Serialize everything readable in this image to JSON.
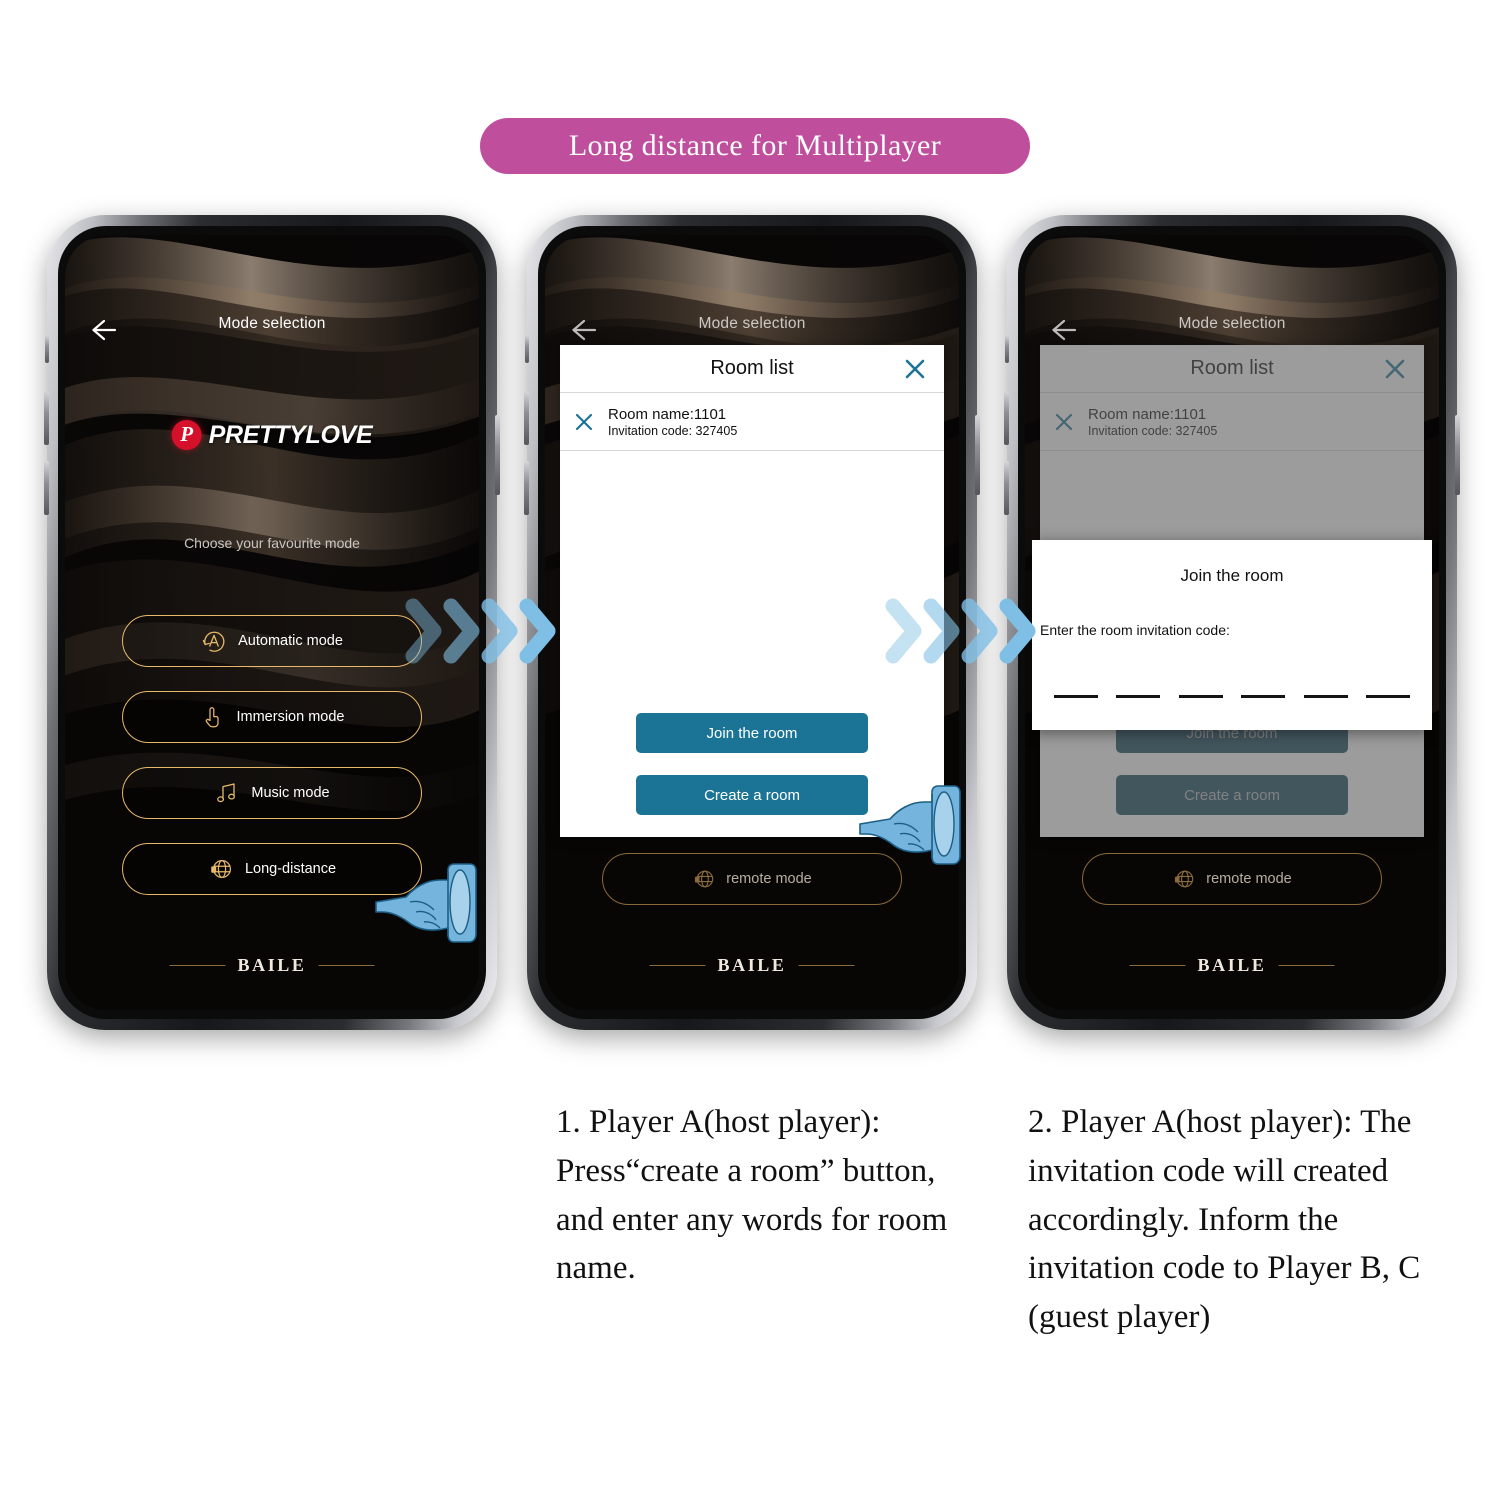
{
  "banner": {
    "title": "Long distance for Multiplayer",
    "color": "#bf4e9d"
  },
  "app": {
    "header_title": "Mode selection",
    "brand_mark": "P",
    "brand_name_bold": "PRETTY",
    "brand_name_light": "LOVE",
    "choose_label": "Choose your favourite mode",
    "footer_brand": "BAILE",
    "accent_gold": "#e7b96a"
  },
  "modes": [
    {
      "label": "Automatic mode",
      "icon": "automatic-mode-icon"
    },
    {
      "label": "Immersion mode",
      "icon": "hand-touch-icon"
    },
    {
      "label": "Music mode",
      "icon": "music-note-icon"
    },
    {
      "label": "Long-distance",
      "icon": "globe-icon"
    }
  ],
  "remote_mode": {
    "label": "remote mode",
    "icon": "globe-icon"
  },
  "room_dialog": {
    "title": "Room list",
    "close_icon": "close-icon",
    "rows": [
      {
        "name_label": "Room name:1101",
        "code_label": "Invitation code:  327405",
        "delete_icon": "close-icon"
      }
    ],
    "join_button": "Join the room",
    "create_button": "Create a room",
    "button_color": "#1b7496"
  },
  "join_modal": {
    "title": "Join the room",
    "prompt": "Enter the room invitation code:",
    "slots": 6
  },
  "captions": [
    "1. Player A(host player): Press“create a room” button, and enter any words for room name.",
    "2. Player A(host player): The invitation code will created accordingly. Inform the invitation code to Player B, C (guest player)"
  ]
}
